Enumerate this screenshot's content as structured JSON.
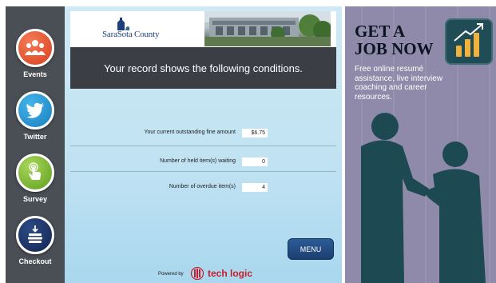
{
  "sidebar": {
    "items": [
      {
        "label": "Events",
        "icon": "people-icon"
      },
      {
        "label": "Twitter",
        "icon": "twitter-bird-icon"
      },
      {
        "label": "Survey",
        "icon": "touch-hand-icon"
      },
      {
        "label": "Checkout",
        "icon": "book-stack-download-icon"
      }
    ]
  },
  "header": {
    "logo_text": "SaraSota County",
    "title": "Your record shows the following conditions."
  },
  "record": {
    "rows": [
      {
        "label": "Your current outstanding fine amount",
        "value": "$6.75"
      },
      {
        "label": "Number of held item(s) waiting",
        "value": "0"
      },
      {
        "label": "Number of overdue item(s)",
        "value": "4"
      }
    ]
  },
  "actions": {
    "menu_label": "MENU"
  },
  "footer": {
    "powered_by": "Powered by",
    "brand": "tech logic"
  },
  "ad": {
    "title_line1": "GET A",
    "title_line2": "JOB NOW",
    "body": "Free online resumé assistance, live interview coaching and career resources.",
    "icon": "bar-chart-growth-icon"
  },
  "colors": {
    "sidebar": "#4a4f55",
    "title_bar": "#3b3f45",
    "panel": "#c5e5f4",
    "menu_button": "#1c3f70",
    "ad_background": "#8f8aa9",
    "brand_red": "#c41f2a"
  }
}
